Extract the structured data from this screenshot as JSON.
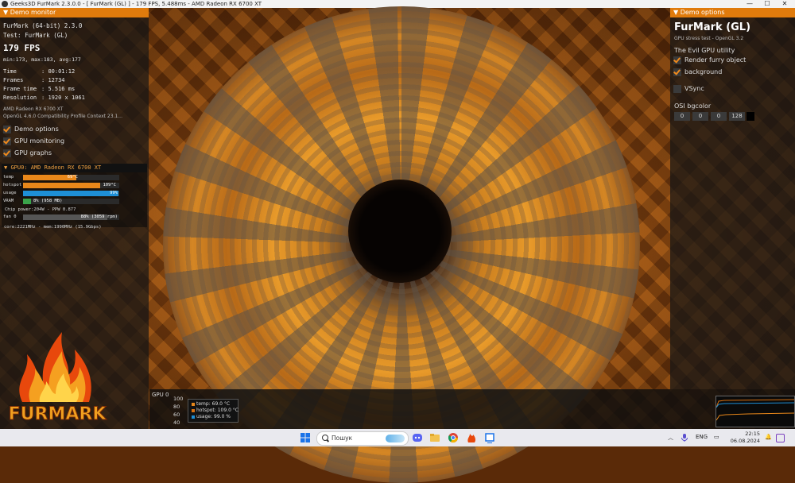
{
  "window": {
    "title": "Geeks3D FurMark 2.3.0.0 - [ FurMark (GL) ] - 179 FPS, 5.488ms - AMD Radeon RX 6700 XT",
    "controls": [
      "—",
      "☐",
      "✕"
    ]
  },
  "demo_monitor": {
    "header": "Demo monitor",
    "app_line": "FurMark (64-bit) 2.3.0",
    "test_line": "Test: FurMark (GL)",
    "fps": "179 FPS",
    "fps_stats": "min:173, max:183, avg:177",
    "stats": [
      {
        "label": "Time",
        "value": "00:01:12"
      },
      {
        "label": "Frames",
        "value": "12734"
      },
      {
        "label": "Frame time",
        "value": "5.516 ms"
      },
      {
        "label": "Resolution",
        "value": "1920 x 1061"
      }
    ],
    "gpu_name": "AMD Radeon RX 6700 XT",
    "gl_info": "OpenGL 4.6.0 Compatibility Profile Context 23.1...",
    "options": [
      {
        "label": "Demo options",
        "checked": true
      },
      {
        "label": "GPU monitoring",
        "checked": true
      },
      {
        "label": "GPU graphs",
        "checked": true
      }
    ]
  },
  "gpu_monitor": {
    "header": "GPU0: AMD Radeon RX 6700 XT",
    "bars": [
      {
        "label": "temp",
        "value": "69°C",
        "fraction": 0.55,
        "color": "#e8871a"
      },
      {
        "label": "hotspot",
        "value": "109°C",
        "fraction": 0.8,
        "color": "#e8871a"
      },
      {
        "label": "usage",
        "value": "99%",
        "fraction": 0.99,
        "color": "#1e8fd6"
      },
      {
        "label": "VRAM",
        "value": "8% (958 MB)",
        "fraction": 0.08,
        "color": "#3aa34a"
      }
    ],
    "chip_power": "Chip power:204W - PPW 0.877",
    "fan_label": "fan 0",
    "fan_value": "88% (3059 rpm)",
    "fan_fraction": 0.88,
    "clocks": "core:2221MHz - mem:1990MHz (15.9Gbps)"
  },
  "logo": {
    "text": "FURMARK"
  },
  "demo_options": {
    "header": "Demo options",
    "title": "FurMark (GL)",
    "subtitle": "GPU stress test - OpenGL 3.2",
    "tagline": "The Evil GPU utility",
    "checkboxes": [
      {
        "label": "Render furry object",
        "checked": true
      },
      {
        "label": "background",
        "checked": true
      },
      {
        "label": "VSync",
        "checked": false
      }
    ],
    "bgcolor_label": "OSI bgcolor",
    "bgcolor_values": [
      "0",
      "0",
      "0",
      "128"
    ],
    "bgcolor_swatch": "#000000"
  },
  "graph": {
    "title": "GPU 0",
    "y_ticks": [
      "100",
      "80",
      "60",
      "40"
    ],
    "legend": [
      {
        "label": "temp: 69.0 °C",
        "color": "#e8871a"
      },
      {
        "label": "hotspot: 109.0 °C",
        "color": "#d87010"
      },
      {
        "label": "usage: 99.0 %",
        "color": "#1e8fd6"
      }
    ]
  },
  "taskbar": {
    "search_placeholder": "Пошук",
    "language": "ENG",
    "time": "22:15",
    "date": "06.08.2024"
  }
}
